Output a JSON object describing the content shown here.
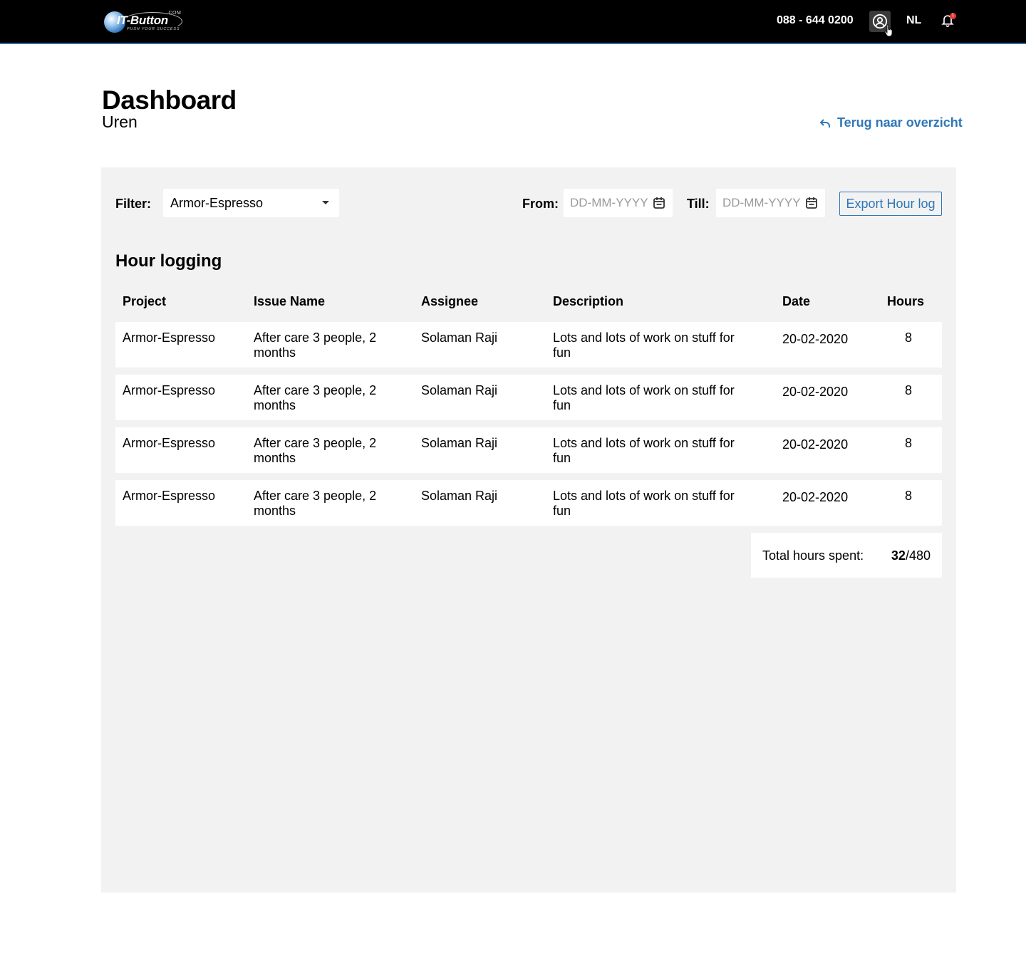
{
  "header": {
    "logo": {
      "brand": "IT-Button",
      "com": ".COM",
      "tagline": "PUSH YOUR SUCCESS"
    },
    "phone": "088 - 644 0200",
    "language": "NL",
    "notification_count": "1"
  },
  "page": {
    "title": "Dashboard",
    "subtitle": "Uren",
    "back_link": "Terug naar overzicht"
  },
  "filters": {
    "filter_label": "Filter:",
    "filter_value": "Armor-Espresso",
    "from_label": "From:",
    "from_placeholder": "DD-MM-YYYY",
    "till_label": "Till:",
    "till_placeholder": "DD-MM-YYYY",
    "export_label": "Export Hour log"
  },
  "hour_logging": {
    "title": "Hour logging",
    "columns": [
      "Project",
      "Issue Name",
      "Assignee",
      "Description",
      "Date",
      "Hours"
    ],
    "rows": [
      {
        "project": "Armor-Espresso",
        "issue_line1": "After care 3 people, 2",
        "issue_line2": "months",
        "assignee": "Solaman Raji",
        "desc_line1": "Lots and lots of work on stuff for",
        "desc_line2": "fun",
        "date": "20-02-2020",
        "hours": "8"
      },
      {
        "project": "Armor-Espresso",
        "issue_line1": "After care 3 people, 2",
        "issue_line2": "months",
        "assignee": "Solaman Raji",
        "desc_line1": "Lots and lots of work on stuff for",
        "desc_line2": "fun",
        "date": "20-02-2020",
        "hours": "8"
      },
      {
        "project": "Armor-Espresso",
        "issue_line1": "After care 3 people, 2",
        "issue_line2": "months",
        "assignee": "Solaman Raji",
        "desc_line1": "Lots and lots of work on stuff for",
        "desc_line2": "fun",
        "date": "20-02-2020",
        "hours": "8"
      },
      {
        "project": "Armor-Espresso",
        "issue_line1": "After care 3 people, 2",
        "issue_line2": "months",
        "assignee": "Solaman Raji",
        "desc_line1": "Lots and lots of work on stuff for",
        "desc_line2": "fun",
        "date": "20-02-2020",
        "hours": "8"
      }
    ],
    "total_label": "Total hours spent:",
    "total_spent": "32",
    "total_budget": "/480"
  },
  "colors": {
    "accent": "#2e78b7",
    "header_bg": "#000000",
    "panel_bg": "#f2f2f2",
    "badge": "#e53935"
  },
  "icons": [
    "user-circle-icon",
    "bell-icon",
    "back-arrow-icon",
    "calendar-icon",
    "caret-down-icon",
    "hand-cursor-icon"
  ]
}
